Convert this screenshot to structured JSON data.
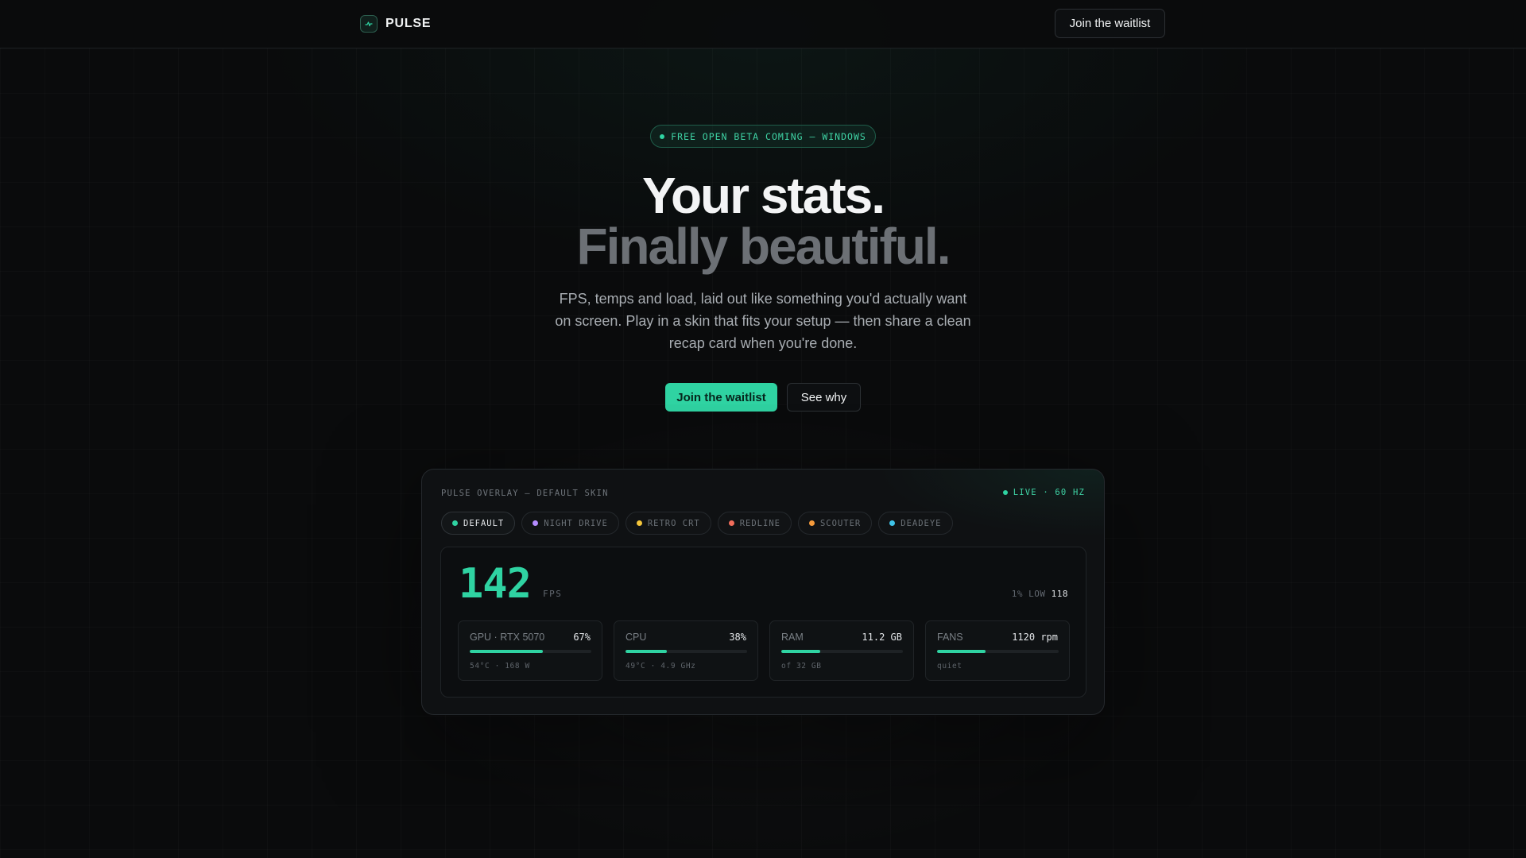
{
  "nav": {
    "brand": "PULSE",
    "cta": "Join the waitlist"
  },
  "hero": {
    "badge": "FREE OPEN BETA COMING — WINDOWS",
    "title_line1": "Your stats.",
    "title_line2": "Finally beautiful.",
    "lead": "FPS, temps and load, laid out like something you'd actually want on screen. Play in a skin that fits your setup — then share a clean recap card when you're done.",
    "primary_cta": "Join the waitlist",
    "secondary_cta": "See why"
  },
  "overlay": {
    "title": "PULSE OVERLAY — DEFAULT SKIN",
    "live": "LIVE · 60 HZ",
    "skins": [
      {
        "label": "DEFAULT",
        "color": "#2fd3a2",
        "active": true
      },
      {
        "label": "NIGHT DRIVE",
        "color": "#b58cff",
        "active": false
      },
      {
        "label": "RETRO CRT",
        "color": "#f5c63b",
        "active": false
      },
      {
        "label": "REDLINE",
        "color": "#f26d5b",
        "active": false
      },
      {
        "label": "SCOUTER",
        "color": "#f59a3b",
        "active": false
      },
      {
        "label": "DEADEYE",
        "color": "#3fc3e8",
        "active": false
      }
    ],
    "fps": {
      "value": "142",
      "unit": "FPS",
      "low_label": "1% LOW",
      "low_value": "118"
    },
    "stats": [
      {
        "label": "GPU · RTX 5070",
        "value": "67%",
        "fill": 0.6,
        "sub": "54°C · 168 W"
      },
      {
        "label": "CPU",
        "value": "38%",
        "fill": 0.34,
        "sub": "49°C · 4.9 GHz"
      },
      {
        "label": "RAM",
        "value": "11.2 GB",
        "fill": 0.32,
        "sub": "of 32 GB"
      },
      {
        "label": "FANS",
        "value": "1120 rpm",
        "fill": 0.4,
        "sub": "quiet"
      }
    ]
  },
  "colors": {
    "accent": "#2fd3a2",
    "background": "#0a0b0c"
  }
}
